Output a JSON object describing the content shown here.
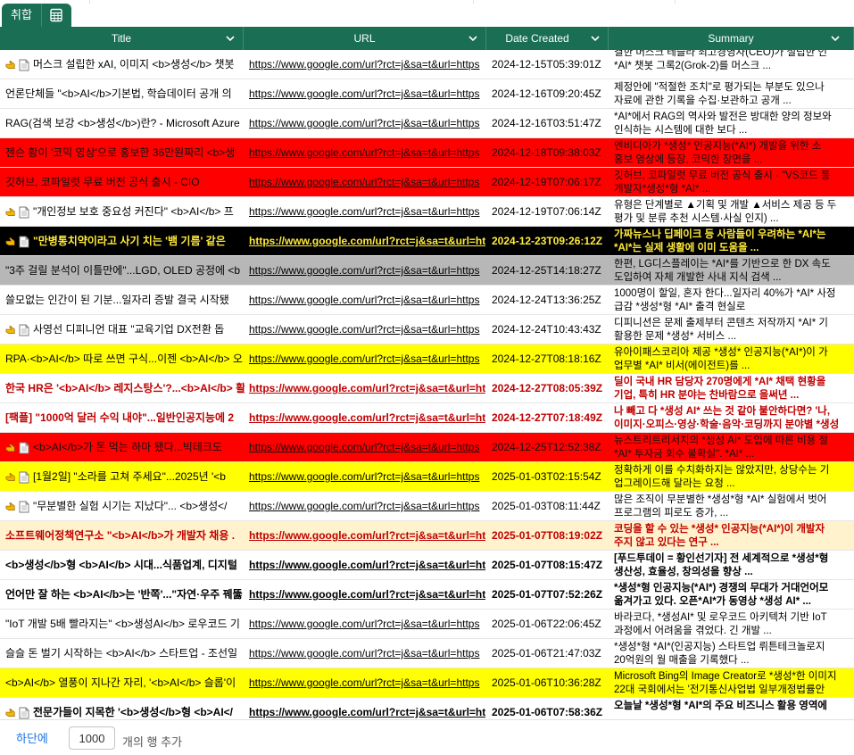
{
  "tabs": {
    "active_label": "취합"
  },
  "columns": [
    "Title",
    "URL",
    "Date Created",
    "Summary"
  ],
  "rows": [
    {
      "style": "top",
      "icons": true,
      "title": "머스크 설립한 xAI, 이미지 <b>생성</b> 챗봇",
      "url": "https://www.google.com/url?rct=j&sa=t&url=https",
      "date": "2024-12-15T05:39:01Z",
      "summary": "결한 머스크 테슬라 최고경영자(CEO)가 설립한 인\n*AI* 챗봇 그록2(Grok-2)를 머스크 ..."
    },
    {
      "style": "",
      "icons": false,
      "title": "언론단체들 \"<b>AI</b>기본법, 학습데이터 공개 의",
      "url": "https://www.google.com/url?rct=j&sa=t&url=https",
      "date": "2024-12-16T09:20:45Z",
      "summary": "제정안에 \"적절한 조치\"로 평가되는 부분도 있으나 \n자료에 관한 기록을 수집·보관하고 공개 ..."
    },
    {
      "style": "",
      "icons": false,
      "title": "RAG(검색 보강 <b>생성</b>)란? - Microsoft Azure",
      "url": "https://www.google.com/url?rct=j&sa=t&url=https",
      "date": "2024-12-16T03:51:47Z",
      "summary": "*AI*에서 RAG의 역사와 발전은 방대한 양의 정보와\n인식하는 시스템에 대한 보다 ..."
    },
    {
      "style": "red",
      "icons": false,
      "title": "젠슨 황이 '코믹 영상'으로 홍보한 36만원짜리 <b>생",
      "url": "https://www.google.com/url?rct=j&sa=t&url=https",
      "date": "2024-12-18T09:38:03Z",
      "summary": "엔비디아가 *생성* 인공지능(*AI*) 개발을 위한 소\n홍보 영상에 등장, 코믹한 장면을 ..."
    },
    {
      "style": "red",
      "icons": false,
      "title": "깃허브, 코파일럿 무료 버전 공식 출시 - CIO",
      "url": "https://www.google.com/url?rct=j&sa=t&url=https",
      "date": "2024-12-19T07:06:17Z",
      "summary": "깃허브, 코파일럿 무료 버전 공식 출시 · \"VS코드 통\n개발자*생성*형 *AI* ..."
    },
    {
      "style": "",
      "icons": true,
      "title": "\"개인정보 보호 중요성 커진다\" <b>AI</b> 프",
      "url": "https://www.google.com/url?rct=j&sa=t&url=https",
      "date": "2024-12-19T07:06:14Z",
      "summary": "유형은 단계별로 ▲기획 및 개발 ▲서비스 제공 등 두\n평가 및 분류 추천 시스템·사실 인지) ..."
    },
    {
      "style": "black",
      "icons": true,
      "title": "\"만병통치약이라고 사기 치는 '뱀 기름' 같은",
      "url": "https://www.google.com/url?rct=j&sa=t&url=https",
      "date": "2024-12-23T09:26:12Z",
      "summary": "가짜뉴스나 딥페이크 등 사람들이 우려하는 *AI*는\n*AI*는 실제 생활에 이미 도움을 ..."
    },
    {
      "style": "gray",
      "icons": false,
      "title": "\"3주 걸릴 분석이 이틀만에\"...LGD, OLED 공정에 <b",
      "url": "https://www.google.com/url?rct=j&sa=t&url=https",
      "date": "2024-12-25T14:18:27Z",
      "summary": "한편, LG디스플레이는 *AI*를 기반으로 한 DX 속도\n도입하여 자체 개발한 사내 지식 검색 ..."
    },
    {
      "style": "",
      "icons": false,
      "title": "쓸모없는 인간이 된 기분...일자리 증발 결국 시작됐",
      "url": "https://www.google.com/url?rct=j&sa=t&url=https",
      "date": "2024-12-24T13:36:25Z",
      "summary": "1000명이 할일, 혼자 한다...일자리 40%가 *AI* 사정\n급감 *생성*형 *AI* 출격 현실로"
    },
    {
      "style": "",
      "icons": true,
      "title": "사영선 디피니언 대표 \"교육기업 DX전환 돕",
      "url": "https://www.google.com/url?rct=j&sa=t&url=https",
      "date": "2024-12-24T10:43:43Z",
      "summary": "디피니션은 문제 출제부터 콘텐츠 저작까지 *AI* 기\n활용한 문제 *생성* 서비스 ..."
    },
    {
      "style": "yellow",
      "icons": false,
      "title": "RPA·<b>AI</b> 따로 쓰면 구식...이젠 <b>AI</b> 오",
      "url": "https://www.google.com/url?rct=j&sa=t&url=https",
      "date": "2024-12-27T08:18:16Z",
      "summary": "유아이패스코리아 제공 *생성* 인공지능(*AI*)이 가\n업무별 *AI* 비서(에이전트)를 ..."
    },
    {
      "style": "redtext",
      "icons": false,
      "title": "한국 HR은 '<b>AI</b> 레지스탕스'?...<b>AI</b> 활",
      "url": "https://www.google.com/url?rct=j&sa=t&url=https",
      "date": "2024-12-27T08:05:39Z",
      "summary": "딜이 국내 HR 담당자 270명에게 *AI* 채택 현황을\n기업, 특히 HR 분야는 찬바람으로 을써년 ..."
    },
    {
      "style": "redtext",
      "icons": false,
      "title": "[팩플] \"1000억 달러 수익 내야\"...일반인공지능에 2",
      "url": "https://www.google.com/url?rct=j&sa=t&url=https",
      "date": "2024-12-27T07:18:49Z",
      "summary": "나 빼고 다 *생성 AI* 쓰는 것 같아 불안하다면? '나,\n이미지·오피스·영상·학술·음악·코딩까지 분야별 *생성"
    },
    {
      "style": "red",
      "icons": true,
      "title": "<b>AI</b>가 돈 먹는 하마 됐다...빅테크도",
      "url": "https://www.google.com/url?rct=j&sa=t&url=https",
      "date": "2024-12-25T12:52:38Z",
      "summary": "뉴스트리트리서치의 *생성 AI* 도입에 따른 비용 절\n*AI* 투자금 회수 불확실\". *AI* ..."
    },
    {
      "style": "yellow",
      "icons": true,
      "title": "[1월2일] \"소라를 고쳐 주세요\"...2025년 '<b",
      "url": "https://www.google.com/url?rct=j&sa=t&url=https",
      "date": "2025-01-03T02:15:54Z",
      "summary": "정확하게 이를 수치화하지는 않았지만, 상당수는 기\n업그레이드해 달라는 요청 ..."
    },
    {
      "style": "",
      "icons": true,
      "title": "\"무분별한 실험 시기는 지났다\"... <b>생성</",
      "url": "https://www.google.com/url?rct=j&sa=t&url=https",
      "date": "2025-01-03T08:11:44Z",
      "summary": "많은 조직이 무분별한 *생성*형 *AI* 실험에서 벗어\n프로그램의 피로도 증가, ..."
    },
    {
      "style": "cream",
      "icons": false,
      "title": "소프트웨어정책연구소 \"<b>AI</b>가 개발자 채용 .",
      "url": "https://www.google.com/url?rct=j&sa=t&url=https",
      "date": "2025-01-07T08:19:02Z",
      "summary": "코딩을 할 수 있는 *생성* 인공지능(*AI*)이 개발자\n주지 않고 있다는 연구 ..."
    },
    {
      "style": "bold",
      "icons": false,
      "title": "<b>생성</b>형 <b>AI</b> 시대...식품업계, 디지털",
      "url": "https://www.google.com/url?rct=j&sa=t&url=https",
      "date": "2025-01-07T08:15:47Z",
      "summary": "[푸드투데이 = 황인선기자] 전 세계적으로 *생성*형\n생산성, 효율성, 창의성을 향상 ..."
    },
    {
      "style": "bold",
      "icons": false,
      "title": "언어만 잘 하는 <b>AI</b>는 '반쪽'...\"자연·우주 꿰뚫",
      "url": "https://www.google.com/url?rct=j&sa=t&url=https",
      "date": "2025-01-07T07:52:26Z",
      "summary": "*생성*형 인공지능(*AI*) 경쟁의 무대가 거대언어모\n옮겨가고 있다. 오픈*AI*가 동영상 *생성 AI* ..."
    },
    {
      "style": "",
      "icons": false,
      "title": "\"IoT 개발 5배 빨라지는\" <b>생성AI</b> 로우코드 기",
      "url": "https://www.google.com/url?rct=j&sa=t&url=https",
      "date": "2025-01-06T22:06:45Z",
      "summary": "바라코다, *생성AI* 및 로우코드 아키텍처 기반 IoT\n과정에서 어려움을 겪었다. 긴 개발 ..."
    },
    {
      "style": "",
      "icons": false,
      "title": "슬슬 돈 벌기 시작하는 <b>AI</b> 스타트업 - 조선일",
      "url": "https://www.google.com/url?rct=j&sa=t&url=https",
      "date": "2025-01-06T21:47:03Z",
      "summary": "*생성*형 *AI*(인공지능) 스타트업 뤼튼테크놀로지\n20억원의 월 매출을 기록했다 ..."
    },
    {
      "style": "yellow",
      "icons": false,
      "title": "<b>AI</b> 열풍이 지나간 자리, '<b>AI</b> 슬롭'이",
      "url": "https://www.google.com/url?rct=j&sa=t&url=https",
      "date": "2025-01-06T10:36:28Z",
      "summary": "Microsoft Bing의 Image Creator로 *생성*한 이미지\n22대 국회에서는 '전기통신사업법 일부개정법률안"
    },
    {
      "style": "bold",
      "icons": true,
      "title": "전문가들이 지목한 '<b>생성</b>형 <b>AI</",
      "url": "https://www.google.com/url?rct=j&sa=t&url=https",
      "date": "2025-01-06T07:58:36Z",
      "summary": "오늘날 *생성*형 *AI*의 주요 비즈니스 활용 영역에"
    }
  ],
  "footer": {
    "link_label": "하단에",
    "row_count_value": "1000",
    "suffix_label": "개의 행 추가"
  },
  "colors": {
    "header": "#1a6e54",
    "red": "#ff0000",
    "yellow": "#ffff00",
    "black": "#000000",
    "gray": "#b7b7b7",
    "cream": "#fff2cc",
    "dark_red_text": "#c00000"
  },
  "icons": [
    "pointing-hand-icon",
    "document-icon",
    "grid-table-icon",
    "chevron-down-icon"
  ]
}
